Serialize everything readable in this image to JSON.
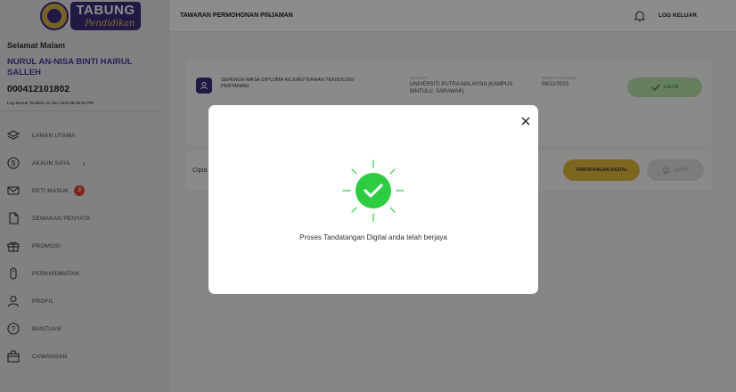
{
  "app": {
    "logo_main": "TABUNG",
    "logo_sub": "Pendidikan"
  },
  "user": {
    "greeting": "Selamat Malam",
    "name": "NURUL AN-NISA BINTI HAIRUL SALLEH",
    "id": "000412101802",
    "last_login": "Log Masuk Terakhir 12 Dec 2023 08:33:53 PM"
  },
  "sidebar": {
    "items": [
      {
        "label": "LAMAN UTAMA",
        "icon": "layers-icon"
      },
      {
        "label": "AKAUN SAYA",
        "icon": "dollar-circle-icon",
        "chevron": "›"
      },
      {
        "label": "PETI MASUK",
        "icon": "mail-icon",
        "badge": "2"
      },
      {
        "label": "SEMAKAN PENYATA",
        "icon": "document-icon"
      },
      {
        "label": "PROMOSI",
        "icon": "gift-icon"
      },
      {
        "label": "PERKHIDMATAN",
        "icon": "mouse-icon"
      },
      {
        "label": "PROFIL",
        "icon": "user-icon"
      },
      {
        "label": "BANTUAN",
        "icon": "help-icon"
      },
      {
        "label": "CAWANGAN",
        "icon": "branch-icon"
      }
    ]
  },
  "header": {
    "title": "TAWARAN PERMOHONAN PINJAMAN",
    "logout_label": "LOG KELUAR"
  },
  "card": {
    "course": "SEPENUH MASA-DIPLOMA KEJURUTERAAN TEKNOLOGI PERTANIAN",
    "ipt_label": "Nama IPT",
    "ipt_value": "UNIVERSITI PUTRA MALAYSIA (KAMPUS BINTULU, SARAWAK)",
    "date_label": "Tarikh Permohonan",
    "date_value": "08/12/2023",
    "status_label": "LULUS"
  },
  "row2": {
    "text": "Cipta",
    "sign_button": "TANDATANGAN DIGITAL",
    "print_button": "CETAK"
  },
  "modal": {
    "message": "Proses Tandatangan Digital anda telah berjaya",
    "close_symbol": "✕"
  },
  "colors": {
    "brand": "#3d2f7a",
    "success": "#2ecc40",
    "accent_yellow": "#e4bc3a",
    "badge": "#e2482b"
  }
}
